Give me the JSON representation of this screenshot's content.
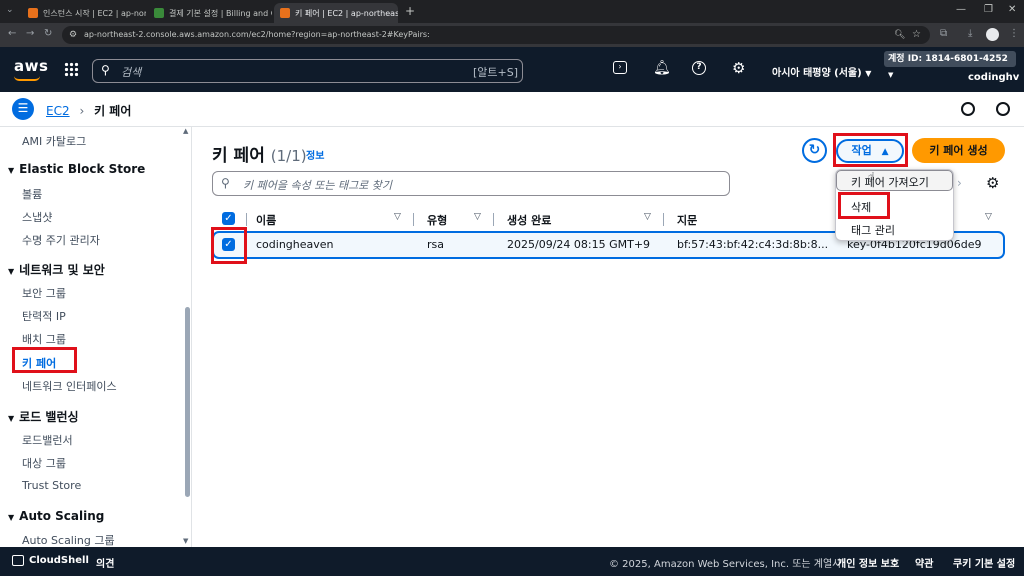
{
  "browser": {
    "tabs": [
      {
        "title": "인스턴스 시작 | EC2 | ap-north"
      },
      {
        "title": "결제 기본 설정 | Billing and Co"
      },
      {
        "title": "키 페어 | EC2 | ap-northeast-2"
      }
    ],
    "url": "ap-northeast-2.console.aws.amazon.com/ec2/home?region=ap-northeast-2#KeyPairs:"
  },
  "aws_header": {
    "logo": "aws",
    "search_placeholder": "검색",
    "search_shortcut": "[알트+S]",
    "region": "아시아 태평양 (서울)",
    "account_id": "계정 ID: 1814-6801-4252",
    "username": "codinghv"
  },
  "breadcrumb": {
    "service": "EC2",
    "page": "키 페어"
  },
  "sidebar": {
    "items": [
      {
        "type": "item",
        "label": "AMI 카탈로그"
      },
      {
        "type": "head",
        "label": "Elastic Block Store"
      },
      {
        "type": "item",
        "label": "볼륨"
      },
      {
        "type": "item",
        "label": "스냅샷"
      },
      {
        "type": "item",
        "label": "수명 주기 관리자"
      },
      {
        "type": "head",
        "label": "네트워크 및 보안"
      },
      {
        "type": "item",
        "label": "보안 그룹"
      },
      {
        "type": "item",
        "label": "탄력적 IP"
      },
      {
        "type": "item",
        "label": "배치 그룹"
      },
      {
        "type": "item",
        "label": "키 페어",
        "active": true
      },
      {
        "type": "item",
        "label": "네트워크 인터페이스"
      },
      {
        "type": "head",
        "label": "로드 밸런싱"
      },
      {
        "type": "item",
        "label": "로드밸런서"
      },
      {
        "type": "item",
        "label": "대상 그룹"
      },
      {
        "type": "item",
        "label": "Trust Store"
      },
      {
        "type": "head",
        "label": "Auto Scaling"
      },
      {
        "type": "item",
        "label": "Auto Scaling 그룹"
      }
    ]
  },
  "main": {
    "title": "키 페어",
    "count": "(1/1)",
    "info": "정보",
    "search_placeholder": "키 페어을 속성 또는 태그로 찾기",
    "actions_label": "작업",
    "create_label": "키 페어 생성",
    "actions_menu": [
      "키 페어 가져오기",
      "삭제",
      "태그 관리"
    ],
    "columns": [
      "이름",
      "유형",
      "생성 완료",
      "지문",
      "ID"
    ],
    "rows": [
      {
        "name": "codingheaven",
        "type": "rsa",
        "created": "2025/09/24 08:15 GMT+9",
        "fingerprint": "bf:57:43:bf:42:c4:3d:8b:8...",
        "id": "key-0f4b120fc19d06de9",
        "selected": true
      }
    ]
  },
  "footer": {
    "cloudshell": "CloudShell",
    "feedback": "의견",
    "copyright": "© 2025, Amazon Web Services, Inc. 또는 계열사.",
    "privacy": "개인 정보 보호",
    "terms": "약관",
    "cookies": "쿠키 기본 설정"
  },
  "colors": {
    "accent": "#006ce0",
    "orange": "#ff9900",
    "highlight_red": "#e0101a",
    "header_bg": "#0f1b2a"
  }
}
